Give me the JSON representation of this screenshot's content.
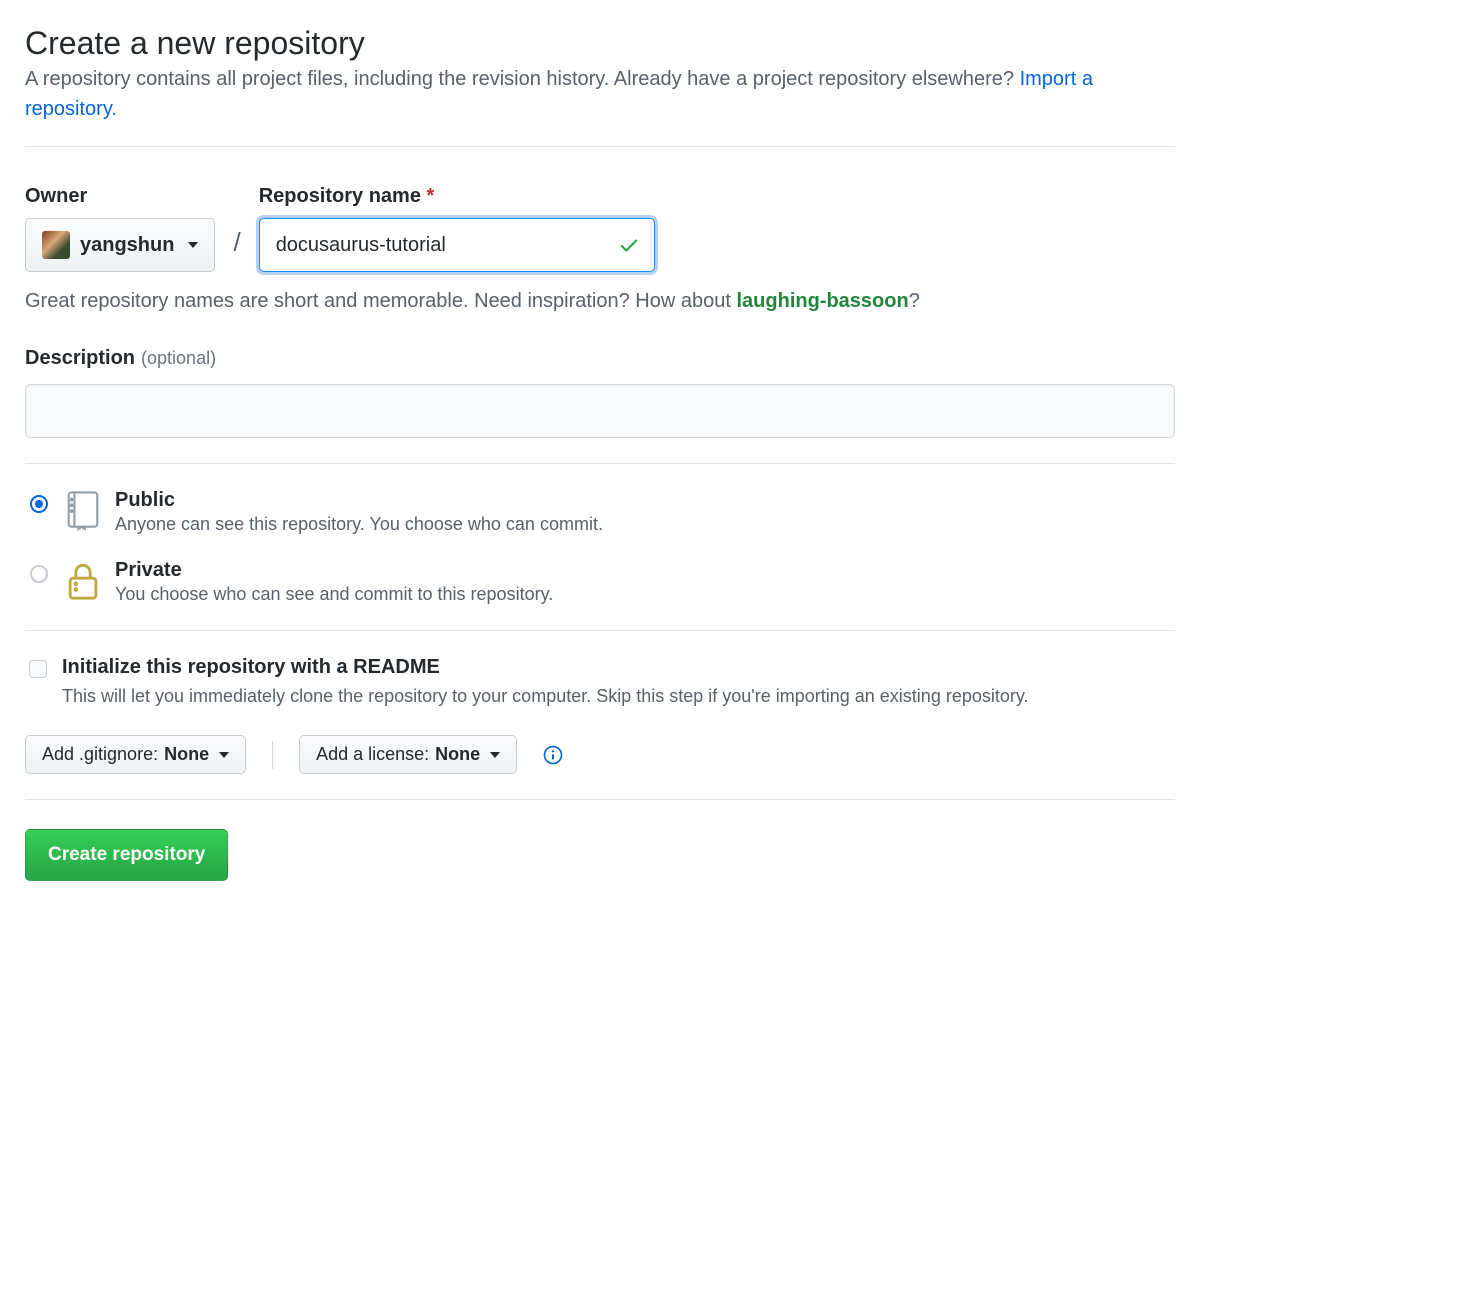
{
  "header": {
    "title": "Create a new repository",
    "subhead_pre": "A repository contains all project files, including the revision history. Already have a project repository elsewhere? ",
    "import_link": "Import a repository."
  },
  "owner": {
    "label": "Owner",
    "name": "yangshun"
  },
  "repo": {
    "label": "Repository name ",
    "value": "docusaurus-tutorial",
    "hint_pre": "Great repository names are short and memorable. Need inspiration? How about ",
    "suggestion": "laughing-bassoon",
    "hint_post": "?"
  },
  "description": {
    "label": "Description",
    "optional": "(optional)",
    "value": ""
  },
  "visibility": {
    "public": {
      "title": "Public",
      "desc": "Anyone can see this repository. You choose who can commit."
    },
    "private": {
      "title": "Private",
      "desc": "You choose who can see and commit to this repository."
    }
  },
  "init": {
    "title": "Initialize this repository with a README",
    "desc": "This will let you immediately clone the repository to your computer. Skip this step if you're importing an existing repository."
  },
  "selects": {
    "gitignore_label": "Add .gitignore: ",
    "gitignore_value": "None",
    "license_label": "Add a license: ",
    "license_value": "None"
  },
  "submit_label": "Create repository"
}
